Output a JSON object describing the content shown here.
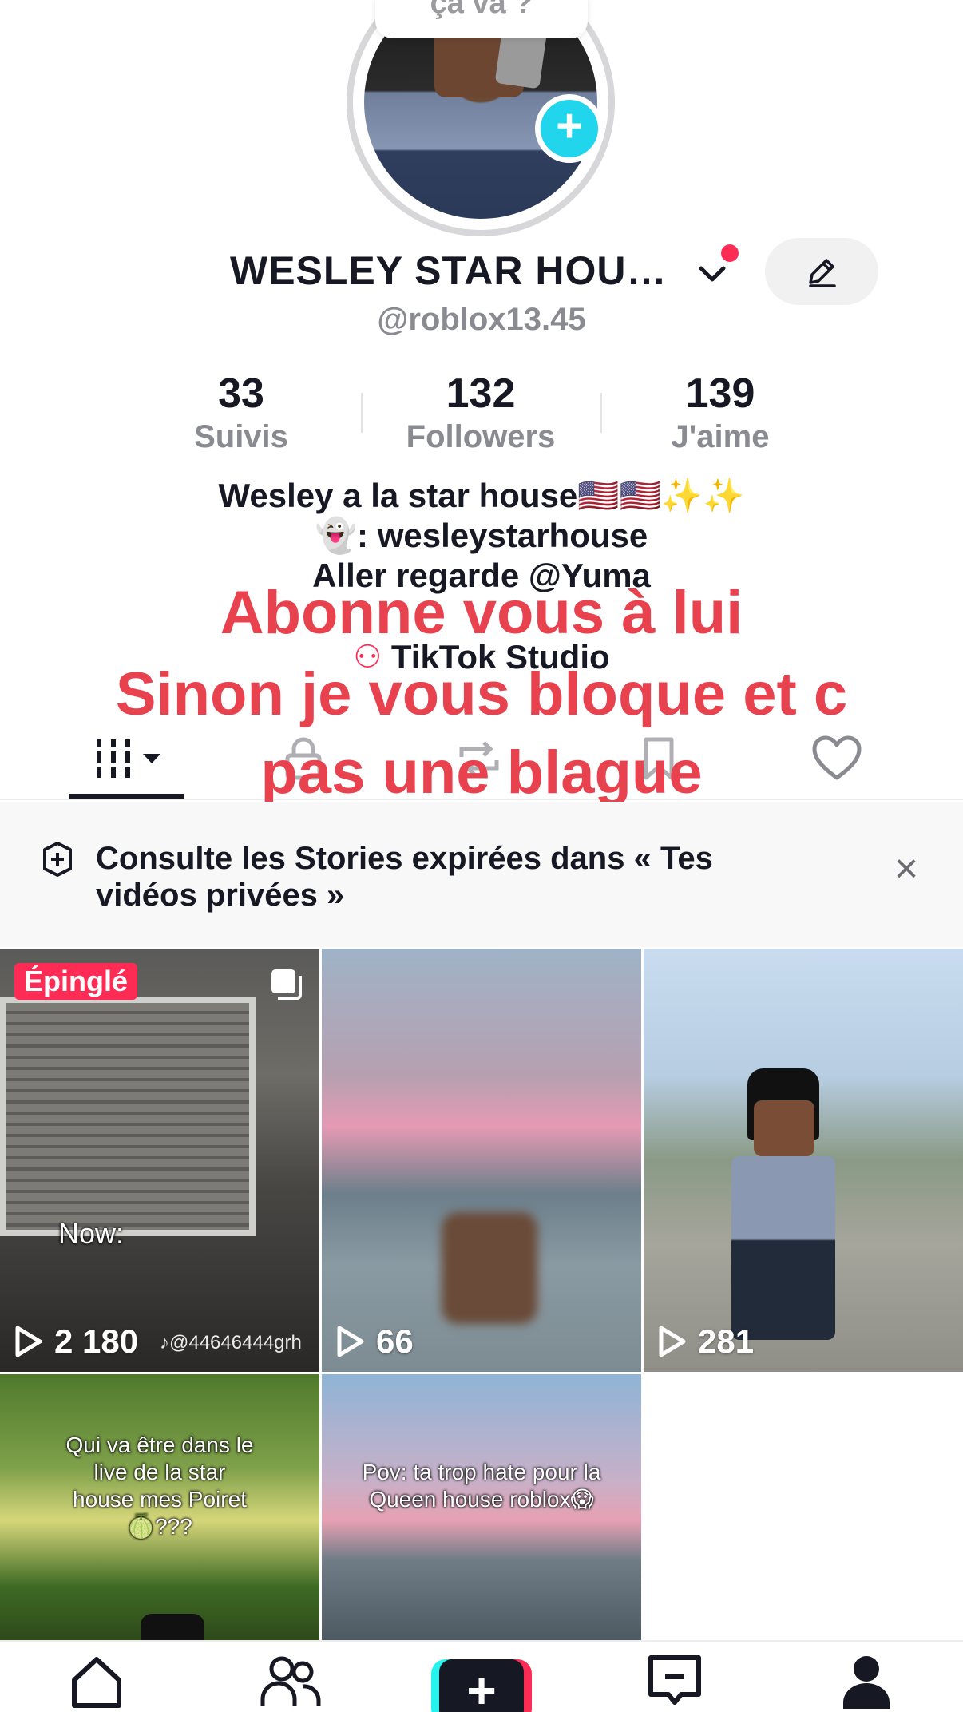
{
  "profile": {
    "note_bubble": "ça va ?",
    "display_name": "WESLEY STAR HOU…",
    "handle": "@roblox13.45"
  },
  "stats": [
    {
      "value": "33",
      "label": "Suivis"
    },
    {
      "value": "132",
      "label": "Followers"
    },
    {
      "value": "139",
      "label": "J'aime"
    }
  ],
  "bio": {
    "line1": "Wesley a la star house🇺🇸🇺🇸✨✨",
    "line2": "👻: wesleystarhouse",
    "line3_prefix": "Aller regarde ",
    "line3_mention": "@Yuma",
    "studio_link": "TikTok Studio"
  },
  "overlay": {
    "line1": "Abonne vous à lui",
    "line2": "Sinon je vous bloque et c",
    "line3": "pas une blague"
  },
  "tabs": [
    {
      "name": "videos",
      "icon": "grid-icon"
    },
    {
      "name": "private",
      "icon": "lock-icon"
    },
    {
      "name": "reposts",
      "icon": "repost-icon"
    },
    {
      "name": "saved",
      "icon": "bookmark-icon"
    },
    {
      "name": "liked",
      "icon": "heart-icon"
    }
  ],
  "banner": {
    "text": "Consulte les Stories expirées dans « Tes vidéos privées »",
    "close": "×"
  },
  "videos": [
    {
      "views": "2 180",
      "pinned_label": "Épinglé",
      "caption": "Now:",
      "watermark": "♪@44646444grh"
    },
    {
      "views": "66"
    },
    {
      "views": "281"
    },
    {
      "caption": "Qui va être dans le live de la star house mes Poiret 🍈???"
    },
    {
      "caption": "Pov: ta trop hate pour la Queen house roblox😱"
    }
  ],
  "colors": {
    "accent_red": "#fe2c55",
    "accent_cyan": "#20d5ec",
    "overlay_red": "#e8424f",
    "text_dark": "#161823",
    "text_gray": "#8a8b91"
  },
  "bottom_nav": [
    {
      "name": "home",
      "icon": "home-icon"
    },
    {
      "name": "friends",
      "icon": "friends-icon"
    },
    {
      "name": "create",
      "icon": "plus-icon",
      "label": "+"
    },
    {
      "name": "inbox",
      "icon": "inbox-icon"
    },
    {
      "name": "profile",
      "icon": "profile-icon"
    }
  ]
}
